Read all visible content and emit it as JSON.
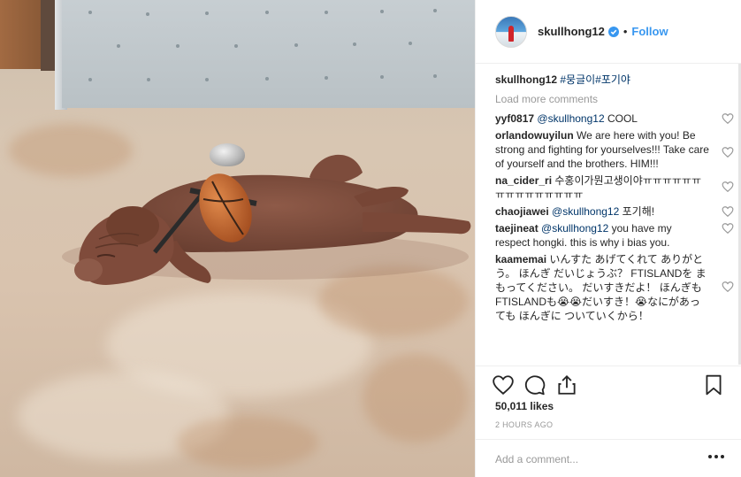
{
  "post": {
    "username": "skullhong12",
    "follow_label": "Follow",
    "separator": "•"
  },
  "caption": {
    "username": "skullhong12",
    "hashtags": "#뭉글이#포기야"
  },
  "load_more": "Load more comments",
  "comments": [
    {
      "username": "yyf0817",
      "mention": "@skullhong12",
      "text": " COOL"
    },
    {
      "username": "orlandowuyilun",
      "mention": "",
      "text": " We are here with you! Be strong and fighting for yourselves!!! Take care of yourself and the brothers. HIM!!!"
    },
    {
      "username": "na_cider_ri",
      "mention": "",
      "text": " 수홍이가뭔고생이야ㅠㅠㅠㅠㅠㅠㅠㅠㅠㅠㅠㅠㅠㅠㅠ"
    },
    {
      "username": "chaojiawei",
      "mention": "@skullhong12",
      "text": " 포기해!"
    },
    {
      "username": "taejineat",
      "mention": "@skullhong12",
      "text": " you have my respect hongki. this is why i bias you."
    },
    {
      "username": "kaamemai",
      "mention": "",
      "text": " いんすた あげてくれて ありがとう。 ほんぎ だいじょうぶ？ FTISLANDを まもってください。 だいすきだよ！ ほんぎも FTISLANDも😭😭だいすき！😭なにがあっても ほんぎに ついていくから！"
    }
  ],
  "likes": "50,011 likes",
  "timestamp": "2 HOURS AGO",
  "add_comment_placeholder": "Add a comment...",
  "icons": {
    "like": "heart-icon",
    "comment": "comment-bubble-icon",
    "share": "share-icon",
    "save": "bookmark-icon",
    "verified": "verified-badge-icon",
    "more": "more-options-icon"
  },
  "colors": {
    "link_blue": "#3897f0",
    "text": "#262626",
    "muted": "#999999",
    "divider": "#efefef",
    "hashtag": "#003569"
  }
}
